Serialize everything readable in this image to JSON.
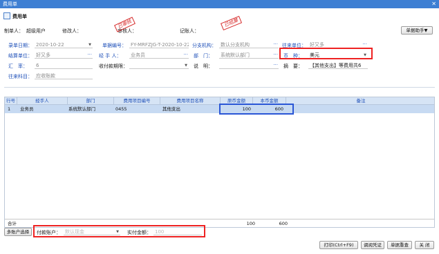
{
  "window": {
    "title": "费用单",
    "close": "✕"
  },
  "doc": {
    "icon": "document-icon",
    "title": "费用单"
  },
  "meta": {
    "creator_label": "制单人：",
    "creator_value": "超级用户",
    "modifier_label": "修改人：",
    "auditor_label": "审核人：",
    "poster_label": "记账人："
  },
  "stamps": {
    "audit": "已审核",
    "posted": "已结算"
  },
  "helper_button": "单据助手▼",
  "form": {
    "date_label": "录单日期：",
    "date_value": "2020-10-22",
    "number_label": "单据编号：",
    "number_value": "FY-MRFZJG-T-2020-10-22",
    "branch_label": "分支机构：",
    "branch_value": "数认分支机构",
    "partner_label": "往来单位：",
    "partner_value": "好又多",
    "settle_label": "结算单位：",
    "settle_value": "好又多",
    "handler_label": "经 手 人：",
    "handler_value": "业务员",
    "dept_label": "部　门：",
    "dept_value": "系统默认部门",
    "currency_label": "币　种：",
    "currency_value": "美元",
    "rate_label": "汇　率：",
    "rate_value": "6",
    "period_label": "收付款期限：",
    "period_value": "",
    "note_label": "说　明：",
    "note_value": "",
    "summary_label": "摘　要：",
    "summary_value": "【其他支出】等费用共6",
    "account_label": "往来科目：",
    "account_value": "应收账款"
  },
  "grid": {
    "headers": [
      "行号",
      "经手人",
      "部门",
      "费用项目编号",
      "费用项目名称",
      "原币金额",
      "本币金额",
      "备注"
    ],
    "rows": [
      [
        "1",
        "业务员",
        "系统默认部门",
        "0455",
        "其他支出",
        "100",
        "600",
        ""
      ]
    ],
    "total_label": "合计",
    "total_orig": "100",
    "total_local": "600"
  },
  "bottom": {
    "multi_account": "多账户选择",
    "pay_account_label": "付款账户：",
    "pay_account_value": "默认现金",
    "paid_label": "实付金额：",
    "paid_value": "100"
  },
  "actions": {
    "print": "打印(Ctrl+F9)",
    "voucher": "调阅凭证",
    "replay": "单据重查",
    "close": "关 闭"
  },
  "colors": {
    "title_bar": "#3e7fd3",
    "highlight_red": "#ee2222",
    "highlight_blue": "#2a56d6",
    "row_selected": "#c7daf2"
  }
}
